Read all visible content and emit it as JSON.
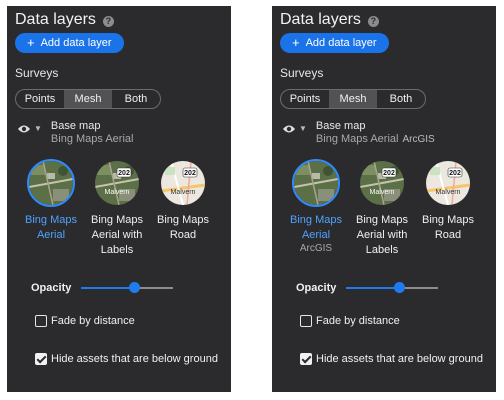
{
  "colors": {
    "accent": "#1a73e8",
    "panel_bg": "#2b2b2d",
    "selected_label": "#4ea2ff"
  },
  "panels": [
    {
      "title": "Data layers",
      "add_button_label": "Add data layer",
      "surveys_label": "Surveys",
      "segments": [
        "Points",
        "Mesh",
        "Both"
      ],
      "active_segment": "Mesh",
      "base_map_title": "Base map",
      "base_map_value": "Bing Maps Aerial",
      "base_map_source": "",
      "maps": [
        {
          "label_lines": [
            "Bing Maps",
            "Aerial"
          ],
          "source": "",
          "selected": true,
          "thumb_type": "aerial"
        },
        {
          "label_lines": [
            "Bing Maps",
            "Aerial with",
            "Labels"
          ],
          "source": "",
          "selected": false,
          "thumb_type": "aerial-labels",
          "thumb_labels": [
            "202",
            "Malvern"
          ]
        },
        {
          "label_lines": [
            "Bing Maps",
            "Road"
          ],
          "source": "",
          "selected": false,
          "thumb_type": "road",
          "thumb_labels": [
            "202",
            "Malvern"
          ]
        }
      ],
      "opacity_label": "Opacity",
      "opacity_value": 0.58,
      "fade_label": "Fade by distance",
      "fade_checked": false,
      "hide_label": "Hide assets that are below ground",
      "hide_checked": true
    },
    {
      "title": "Data layers",
      "add_button_label": "Add data layer",
      "surveys_label": "Surveys",
      "segments": [
        "Points",
        "Mesh",
        "Both"
      ],
      "active_segment": "Mesh",
      "base_map_title": "Base map",
      "base_map_value": "Bing Maps Aerial",
      "base_map_source": "ArcGIS",
      "maps": [
        {
          "label_lines": [
            "Bing Maps",
            "Aerial"
          ],
          "source": "ArcGIS",
          "selected": true,
          "thumb_type": "aerial"
        },
        {
          "label_lines": [
            "Bing Maps",
            "Aerial with",
            "Labels"
          ],
          "source": "",
          "selected": false,
          "thumb_type": "aerial-labels",
          "thumb_labels": [
            "202",
            "Malvern"
          ]
        },
        {
          "label_lines": [
            "Bing Maps",
            "Road"
          ],
          "source": "",
          "selected": false,
          "thumb_type": "road",
          "thumb_labels": [
            "202",
            "Malvern"
          ]
        }
      ],
      "opacity_label": "Opacity",
      "opacity_value": 0.58,
      "fade_label": "Fade by distance",
      "fade_checked": false,
      "hide_label": "Hide assets that are below ground",
      "hide_checked": true
    }
  ]
}
